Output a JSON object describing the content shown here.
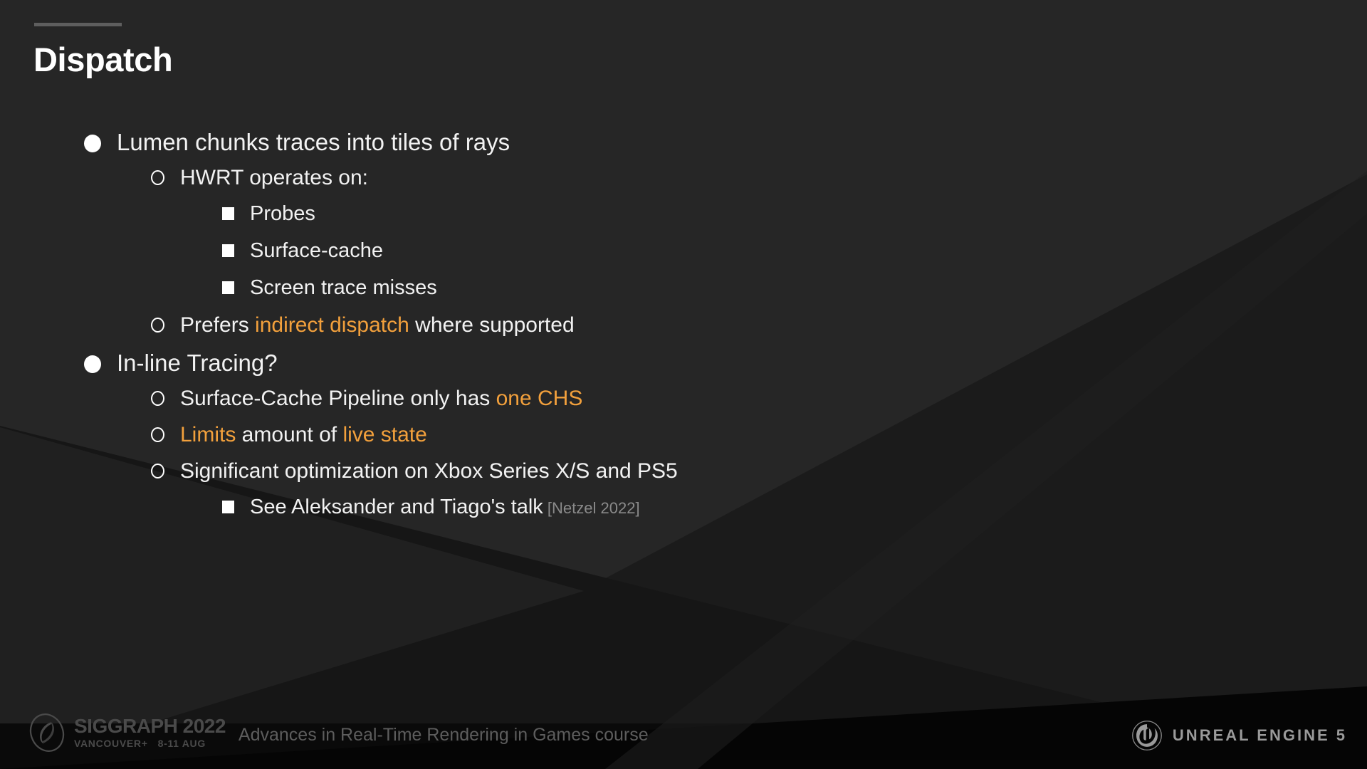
{
  "slide": {
    "title": "Dispatch",
    "accent_color": "#f2a03c",
    "background_color": "#262626",
    "text_color": "#f2f2f2"
  },
  "content": {
    "items": [
      {
        "level": 1,
        "marker": "filled-circle",
        "segments": [
          {
            "text": "Lumen chunks traces into tiles of rays",
            "style": "plain"
          }
        ]
      },
      {
        "level": 2,
        "marker": "hollow-circle",
        "segments": [
          {
            "text": "HWRT operates on:",
            "style": "plain"
          }
        ]
      },
      {
        "level": 3,
        "marker": "filled-square",
        "segments": [
          {
            "text": "Probes",
            "style": "plain"
          }
        ]
      },
      {
        "level": 3,
        "marker": "filled-square",
        "segments": [
          {
            "text": "Surface-cache",
            "style": "plain"
          }
        ]
      },
      {
        "level": 3,
        "marker": "filled-square",
        "segments": [
          {
            "text": "Screen trace misses",
            "style": "plain"
          }
        ]
      },
      {
        "level": 2,
        "marker": "hollow-circle",
        "segments": [
          {
            "text": "Prefers ",
            "style": "plain"
          },
          {
            "text": "indirect dispatch",
            "style": "highlight"
          },
          {
            "text": " where supported",
            "style": "plain"
          }
        ]
      },
      {
        "level": 1,
        "marker": "filled-circle",
        "segments": [
          {
            "text": "In-line Tracing?",
            "style": "plain"
          }
        ]
      },
      {
        "level": 2,
        "marker": "hollow-circle",
        "segments": [
          {
            "text": "Surface-Cache Pipeline only has ",
            "style": "plain"
          },
          {
            "text": "one CHS",
            "style": "highlight"
          }
        ]
      },
      {
        "level": 2,
        "marker": "hollow-circle",
        "segments": [
          {
            "text": "Limits",
            "style": "highlight"
          },
          {
            "text": " amount of ",
            "style": "plain"
          },
          {
            "text": "live state",
            "style": "highlight"
          }
        ]
      },
      {
        "level": 2,
        "marker": "hollow-circle",
        "segments": [
          {
            "text": "Significant optimization on Xbox Series X/S and PS5",
            "style": "plain"
          }
        ]
      },
      {
        "level": 3,
        "marker": "filled-square",
        "segments": [
          {
            "text": "See Aleksander and Tiago's talk",
            "style": "plain"
          },
          {
            "text": " [Netzel 2022]",
            "style": "citation"
          }
        ]
      }
    ]
  },
  "footer": {
    "siggraph_title": "SIGGRAPH 2022",
    "siggraph_location": "VANCOUVER+",
    "siggraph_dates": "8-11 AUG",
    "course_name": "Advances in Real-Time Rendering in Games course",
    "unreal_wordmark": "UNREAL ENGINE 5"
  }
}
